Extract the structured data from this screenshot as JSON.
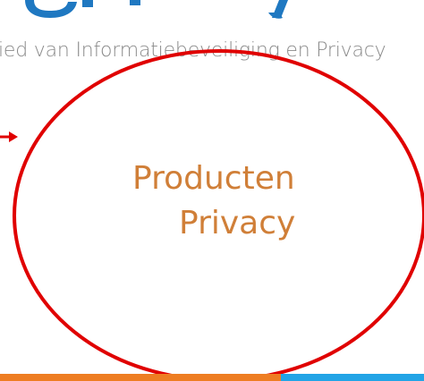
{
  "subtitle": "ied van Informatiebeveiliging en Privacy",
  "product": {
    "line1": "Producten",
    "line2": "Privacy"
  },
  "colors": {
    "title_blue": "#1f78c1",
    "subtitle_gray": "#8a8a8a",
    "product_orange": "#d07f38",
    "annotation_red": "#e00000",
    "bar_orange": "#ee7d22",
    "bar_blue": "#22a4e6"
  },
  "icons": {
    "annotation": "red-circle-with-arrow"
  }
}
